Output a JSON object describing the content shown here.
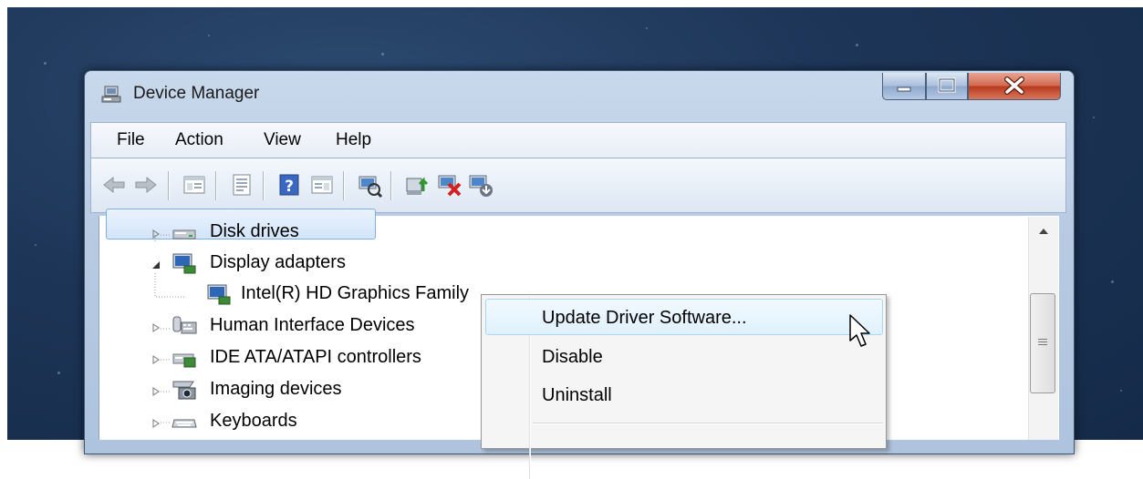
{
  "window": {
    "title": "Device Manager"
  },
  "menubar": {
    "items": [
      "File",
      "Action",
      "View",
      "Help"
    ]
  },
  "toolbar": {
    "buttons": [
      "back-arrow-icon",
      "forward-arrow-icon",
      "show-hide-console-tree-icon",
      "properties-icon",
      "help-icon",
      "show-action-pane-icon",
      "scan-hardware-icon",
      "update-driver-icon",
      "disable-device-icon",
      "uninstall-device-icon"
    ]
  },
  "tree": {
    "items": [
      {
        "label": "Disk drives",
        "icon": "disk-drive-icon",
        "state": "collapsed"
      },
      {
        "label": "Display adapters",
        "icon": "display-adapter-icon",
        "state": "expanded"
      },
      {
        "label": "Intel(R) HD Graphics Family",
        "icon": "display-adapter-icon",
        "state": "selected-child"
      },
      {
        "label": "Human Interface Devices",
        "icon": "hid-icon",
        "state": "collapsed"
      },
      {
        "label": "IDE ATA/ATAPI controllers",
        "icon": "ide-controller-icon",
        "state": "collapsed"
      },
      {
        "label": "Imaging devices",
        "icon": "camera-icon",
        "state": "collapsed"
      },
      {
        "label": "Keyboards",
        "icon": "keyboard-icon",
        "state": "collapsed"
      }
    ]
  },
  "context_menu": {
    "items": [
      "Update Driver Software...",
      "Disable",
      "Uninstall"
    ],
    "highlighted": "Update Driver Software..."
  },
  "colors": {
    "titlebar": "#b8cbe3",
    "close_button": "#c8452a",
    "selection": "#d3e5fa",
    "menu_highlight": "#e0f1fd"
  }
}
